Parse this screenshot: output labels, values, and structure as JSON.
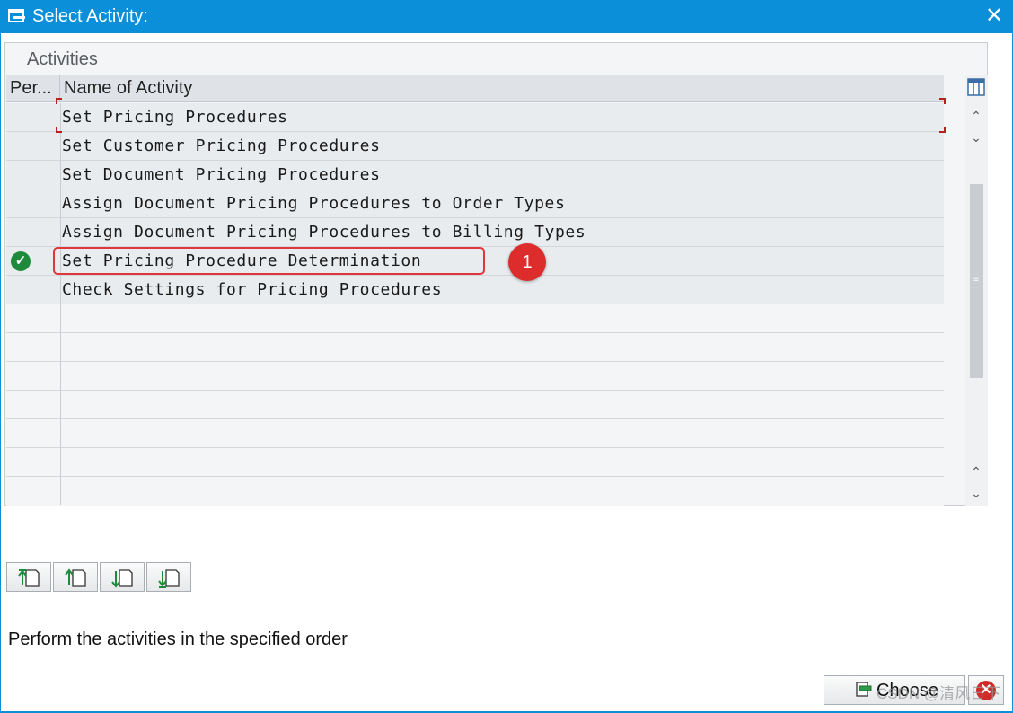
{
  "window": {
    "title": "Select Activity:",
    "close_glyph": "✕",
    "title_icon": "dialog-icon"
  },
  "panel": {
    "title": "Activities"
  },
  "table": {
    "columns": [
      "Per...",
      "Name of Activity"
    ],
    "rows": [
      {
        "performed": false,
        "name": "Set Pricing Procedures"
      },
      {
        "performed": false,
        "name": "Set Customer Pricing Procedures"
      },
      {
        "performed": false,
        "name": "Set Document Pricing Procedures"
      },
      {
        "performed": false,
        "name": "Assign Document Pricing Procedures to Order Types"
      },
      {
        "performed": false,
        "name": "Assign Document Pricing Procedures to Billing Types"
      },
      {
        "performed": true,
        "name": "Set Pricing Procedure Determination"
      },
      {
        "performed": false,
        "name": "Check Settings for Pricing Procedures"
      }
    ],
    "check_glyph": "✓"
  },
  "annotation": {
    "badge": "1",
    "color": "#e0383a"
  },
  "scrollbar": {
    "up": "⌃",
    "down": "⌄",
    "grip": "≡"
  },
  "toolbar_icons": [
    "move-to-top-icon",
    "move-up-icon",
    "move-down-icon",
    "move-to-bottom-icon"
  ],
  "status": {
    "text": "Perform the activities in the specified order"
  },
  "buttons": {
    "choose_label": "Choose",
    "cancel_glyph": "✕"
  },
  "watermark": "CSDN @清风日下",
  "colors": {
    "titlebar": "#0a8fd8",
    "check": "#1d8a3c",
    "cancel": "#d22b2b"
  }
}
